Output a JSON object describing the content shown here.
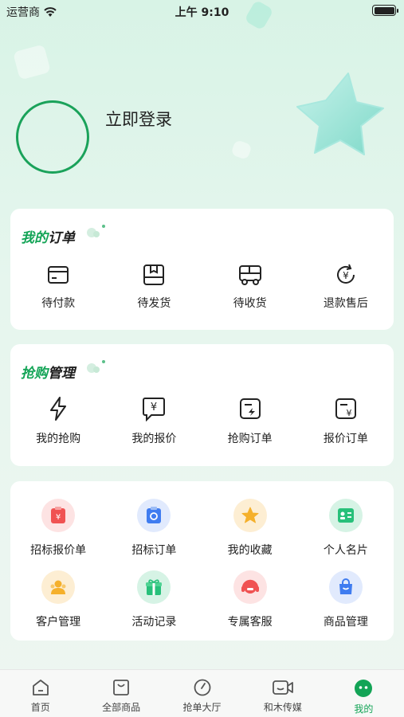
{
  "status": {
    "carrier": "运营商",
    "time": "上午 9:10"
  },
  "profile": {
    "login_text": "立即登录"
  },
  "orders": {
    "title_accent": "我的",
    "title_rest": "订单",
    "items": [
      {
        "label": "待付款",
        "icon": "card-icon"
      },
      {
        "label": "待发货",
        "icon": "box-icon"
      },
      {
        "label": "待收货",
        "icon": "truck-icon"
      },
      {
        "label": "退款售后",
        "icon": "refund-icon"
      }
    ]
  },
  "rush": {
    "title_accent": "抢购",
    "title_rest": "管理",
    "items": [
      {
        "label": "我的抢购",
        "icon": "lightning-icon"
      },
      {
        "label": "我的报价",
        "icon": "quote-bubble-icon"
      },
      {
        "label": "抢购订单",
        "icon": "rush-order-icon"
      },
      {
        "label": "报价订单",
        "icon": "quote-order-icon"
      }
    ]
  },
  "tools": {
    "items": [
      {
        "label": "招标报价单",
        "icon": "tender-quote-icon",
        "color": "#f05252"
      },
      {
        "label": "招标订单",
        "icon": "tender-order-icon",
        "color": "#3f7cf0"
      },
      {
        "label": "我的收藏",
        "icon": "star-icon",
        "color": "#f5b02b"
      },
      {
        "label": "个人名片",
        "icon": "business-card-icon",
        "color": "#27c07a"
      },
      {
        "label": "客户管理",
        "icon": "customer-icon",
        "color": "#f5b02b"
      },
      {
        "label": "活动记录",
        "icon": "gift-icon",
        "color": "#27c07a"
      },
      {
        "label": "专属客服",
        "icon": "headset-icon",
        "color": "#f05252"
      },
      {
        "label": "商品管理",
        "icon": "bag-icon",
        "color": "#3f7cf0"
      }
    ]
  },
  "tabbar": {
    "items": [
      {
        "label": "首页",
        "icon": "home-icon"
      },
      {
        "label": "全部商品",
        "icon": "shopping-bag-icon"
      },
      {
        "label": "抢单大厅",
        "icon": "clock-icon"
      },
      {
        "label": "和木传媒",
        "icon": "video-icon"
      },
      {
        "label": "我的",
        "icon": "profile-face-icon",
        "active": true
      }
    ]
  },
  "colors": {
    "accent": "#13a456",
    "avatar_ring": "#1aa25a"
  }
}
